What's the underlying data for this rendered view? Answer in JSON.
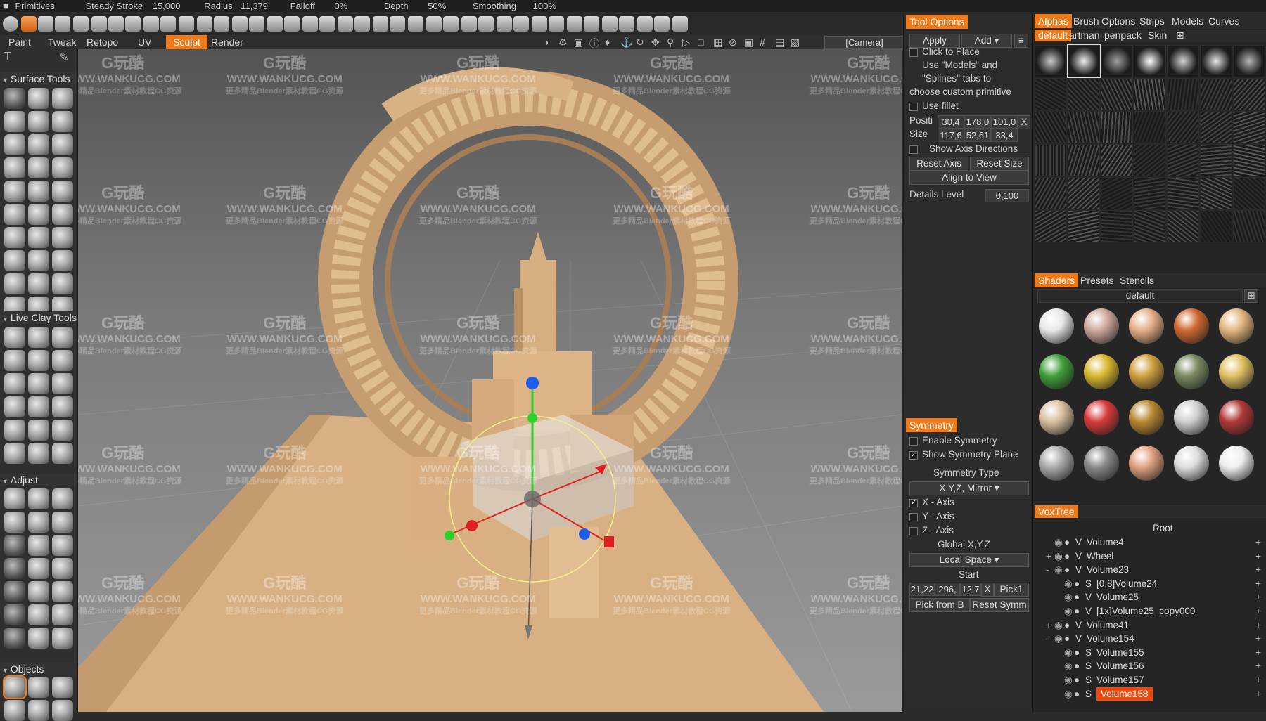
{
  "topbar": {
    "primitives": "Primitives",
    "steady_stroke": "Steady Stroke",
    "steady_stroke_value": "15,000",
    "radius_label": "Radius",
    "radius_value": "11,379",
    "falloff_label": "Falloff",
    "falloff_value": "0%",
    "depth_label": "Depth",
    "depth_value": "50%",
    "smoothing_label": "Smoothing",
    "smoothing_value": "100%"
  },
  "rooms": [
    "Paint",
    "Tweak",
    "Retopo",
    "UV",
    "Sculpt",
    "Render"
  ],
  "active_room": "Sculpt",
  "camera": "[Camera]",
  "left_panel": {
    "sections": [
      "Surface Tools",
      "Live Clay Tools",
      "Adjust",
      "Objects"
    ]
  },
  "tool_options": {
    "title": "Tool Options",
    "apply": "Apply",
    "add": "Add",
    "hint_line1": "Click to Place",
    "hint_line2": "Use \"Models\" and",
    "hint_line3": "\"Splines\" tabs to",
    "hint_line4": "choose custom primitive",
    "use_fillet": "Use fillet",
    "position_label": "Positi",
    "position_values": [
      "30,4",
      "178,0",
      "101,0"
    ],
    "size_label": "Size",
    "size_values": [
      "117,6",
      "52,61",
      "33,4"
    ],
    "x_btn": "X",
    "show_axis": "Show Axis Directions",
    "reset_axis": "Reset Axis",
    "reset_size": "Reset Size",
    "align_view": "Align to View",
    "details_label": "Details Level",
    "details_value": "0,100"
  },
  "symmetry": {
    "title": "Symmetry",
    "enable": "Enable Symmetry",
    "enable_checked": false,
    "show_plane": "Show Symmetry Plane",
    "show_plane_checked": true,
    "type_label": "Symmetry Type",
    "type_value": "X,Y,Z, Mirror",
    "x_axis": "X - Axis",
    "y_axis": "Y - Axis",
    "z_axis": "Z - Axis",
    "global": "Global X,Y,Z",
    "space": "Local Space",
    "start_label": "Start",
    "start_values": [
      "21,22",
      "296,",
      "12,7"
    ],
    "x_btn": "X",
    "pick1": "Pick1",
    "pick_from": "Pick from B",
    "reset_symm": "Reset Symm"
  },
  "right_panel": {
    "tabs": [
      "Alphas",
      "Brush",
      "Options",
      "Strips",
      "Models",
      "Curves"
    ],
    "alpha_sets": [
      "default",
      "artman",
      "penpack",
      "Skin"
    ],
    "shader_tabs": [
      "Shaders",
      "Presets",
      "Stencils"
    ],
    "shader_set": "default",
    "voxtree_title": "VoxTree",
    "voxtree_root": "Root",
    "voxtree": [
      {
        "type": "V",
        "name": "Volume4",
        "indent": 0,
        "expander": ""
      },
      {
        "type": "V",
        "name": "Wheel",
        "indent": 0,
        "expander": "+"
      },
      {
        "type": "V",
        "name": "Volume23",
        "indent": 0,
        "expander": "-"
      },
      {
        "type": "S",
        "name": "[0,8]Volume24",
        "indent": 1,
        "expander": ""
      },
      {
        "type": "V",
        "name": "Volume25",
        "indent": 1,
        "expander": ""
      },
      {
        "type": "V",
        "name": "[1x]Volume25_copy000",
        "indent": 1,
        "expander": ""
      },
      {
        "type": "V",
        "name": "Volume41",
        "indent": 0,
        "expander": "+"
      },
      {
        "type": "V",
        "name": "Volume154",
        "indent": 0,
        "expander": "-"
      },
      {
        "type": "S",
        "name": "Volume155",
        "indent": 1,
        "expander": ""
      },
      {
        "type": "S",
        "name": "Volume156",
        "indent": 1,
        "expander": ""
      },
      {
        "type": "S",
        "name": "Volume157",
        "indent": 1,
        "expander": ""
      },
      {
        "type": "S",
        "name": "Volume158",
        "indent": 1,
        "expander": "",
        "selected": true
      }
    ]
  },
  "watermark": {
    "line1": "G玩酷",
    "line2": "WWW.WANKUCG.COM",
    "line3": "更多精品Blender素材教程CG资源"
  },
  "colors": {
    "accent": "#f07a1a",
    "selection": "#f04a10",
    "model": "#d9b083"
  }
}
